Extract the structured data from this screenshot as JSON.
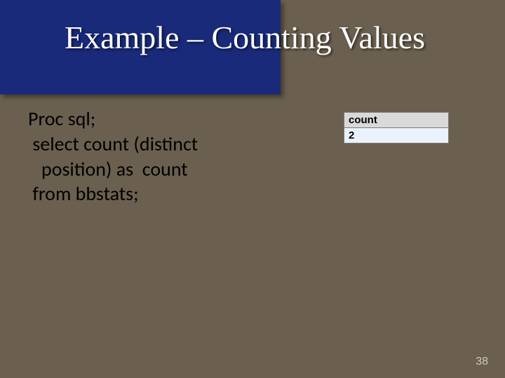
{
  "title": "Example – Counting Values",
  "code": {
    "line1": "Proc sql;",
    "line2": " select count (distinct",
    "line3": "   position) as  count",
    "line4": " from bbstats;"
  },
  "result": {
    "header": "count",
    "value": "2"
  },
  "page_number": "38",
  "chart_data": {
    "type": "table",
    "title": "count",
    "columns": [
      "count"
    ],
    "rows": [
      [
        2
      ]
    ]
  }
}
